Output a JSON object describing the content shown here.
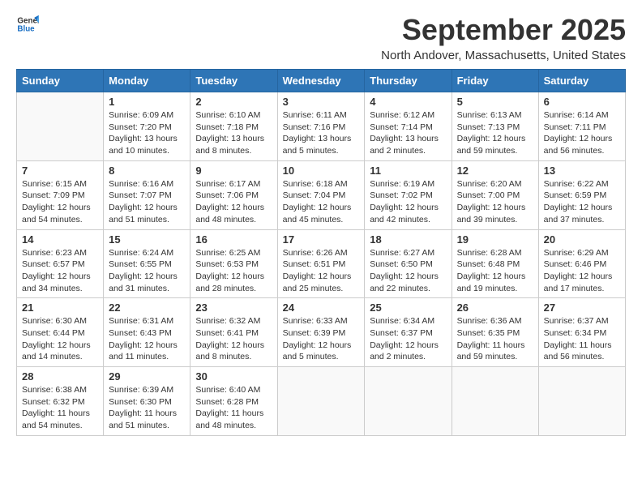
{
  "header": {
    "logo_general": "General",
    "logo_blue": "Blue",
    "month": "September 2025",
    "location": "North Andover, Massachusetts, United States"
  },
  "days_of_week": [
    "Sunday",
    "Monday",
    "Tuesday",
    "Wednesday",
    "Thursday",
    "Friday",
    "Saturday"
  ],
  "weeks": [
    [
      {
        "day": "",
        "content": ""
      },
      {
        "day": "1",
        "content": "Sunrise: 6:09 AM\nSunset: 7:20 PM\nDaylight: 13 hours\nand 10 minutes."
      },
      {
        "day": "2",
        "content": "Sunrise: 6:10 AM\nSunset: 7:18 PM\nDaylight: 13 hours\nand 8 minutes."
      },
      {
        "day": "3",
        "content": "Sunrise: 6:11 AM\nSunset: 7:16 PM\nDaylight: 13 hours\nand 5 minutes."
      },
      {
        "day": "4",
        "content": "Sunrise: 6:12 AM\nSunset: 7:14 PM\nDaylight: 13 hours\nand 2 minutes."
      },
      {
        "day": "5",
        "content": "Sunrise: 6:13 AM\nSunset: 7:13 PM\nDaylight: 12 hours\nand 59 minutes."
      },
      {
        "day": "6",
        "content": "Sunrise: 6:14 AM\nSunset: 7:11 PM\nDaylight: 12 hours\nand 56 minutes."
      }
    ],
    [
      {
        "day": "7",
        "content": "Sunrise: 6:15 AM\nSunset: 7:09 PM\nDaylight: 12 hours\nand 54 minutes."
      },
      {
        "day": "8",
        "content": "Sunrise: 6:16 AM\nSunset: 7:07 PM\nDaylight: 12 hours\nand 51 minutes."
      },
      {
        "day": "9",
        "content": "Sunrise: 6:17 AM\nSunset: 7:06 PM\nDaylight: 12 hours\nand 48 minutes."
      },
      {
        "day": "10",
        "content": "Sunrise: 6:18 AM\nSunset: 7:04 PM\nDaylight: 12 hours\nand 45 minutes."
      },
      {
        "day": "11",
        "content": "Sunrise: 6:19 AM\nSunset: 7:02 PM\nDaylight: 12 hours\nand 42 minutes."
      },
      {
        "day": "12",
        "content": "Sunrise: 6:20 AM\nSunset: 7:00 PM\nDaylight: 12 hours\nand 39 minutes."
      },
      {
        "day": "13",
        "content": "Sunrise: 6:22 AM\nSunset: 6:59 PM\nDaylight: 12 hours\nand 37 minutes."
      }
    ],
    [
      {
        "day": "14",
        "content": "Sunrise: 6:23 AM\nSunset: 6:57 PM\nDaylight: 12 hours\nand 34 minutes."
      },
      {
        "day": "15",
        "content": "Sunrise: 6:24 AM\nSunset: 6:55 PM\nDaylight: 12 hours\nand 31 minutes."
      },
      {
        "day": "16",
        "content": "Sunrise: 6:25 AM\nSunset: 6:53 PM\nDaylight: 12 hours\nand 28 minutes."
      },
      {
        "day": "17",
        "content": "Sunrise: 6:26 AM\nSunset: 6:51 PM\nDaylight: 12 hours\nand 25 minutes."
      },
      {
        "day": "18",
        "content": "Sunrise: 6:27 AM\nSunset: 6:50 PM\nDaylight: 12 hours\nand 22 minutes."
      },
      {
        "day": "19",
        "content": "Sunrise: 6:28 AM\nSunset: 6:48 PM\nDaylight: 12 hours\nand 19 minutes."
      },
      {
        "day": "20",
        "content": "Sunrise: 6:29 AM\nSunset: 6:46 PM\nDaylight: 12 hours\nand 17 minutes."
      }
    ],
    [
      {
        "day": "21",
        "content": "Sunrise: 6:30 AM\nSunset: 6:44 PM\nDaylight: 12 hours\nand 14 minutes."
      },
      {
        "day": "22",
        "content": "Sunrise: 6:31 AM\nSunset: 6:43 PM\nDaylight: 12 hours\nand 11 minutes."
      },
      {
        "day": "23",
        "content": "Sunrise: 6:32 AM\nSunset: 6:41 PM\nDaylight: 12 hours\nand 8 minutes."
      },
      {
        "day": "24",
        "content": "Sunrise: 6:33 AM\nSunset: 6:39 PM\nDaylight: 12 hours\nand 5 minutes."
      },
      {
        "day": "25",
        "content": "Sunrise: 6:34 AM\nSunset: 6:37 PM\nDaylight: 12 hours\nand 2 minutes."
      },
      {
        "day": "26",
        "content": "Sunrise: 6:36 AM\nSunset: 6:35 PM\nDaylight: 11 hours\nand 59 minutes."
      },
      {
        "day": "27",
        "content": "Sunrise: 6:37 AM\nSunset: 6:34 PM\nDaylight: 11 hours\nand 56 minutes."
      }
    ],
    [
      {
        "day": "28",
        "content": "Sunrise: 6:38 AM\nSunset: 6:32 PM\nDaylight: 11 hours\nand 54 minutes."
      },
      {
        "day": "29",
        "content": "Sunrise: 6:39 AM\nSunset: 6:30 PM\nDaylight: 11 hours\nand 51 minutes."
      },
      {
        "day": "30",
        "content": "Sunrise: 6:40 AM\nSunset: 6:28 PM\nDaylight: 11 hours\nand 48 minutes."
      },
      {
        "day": "",
        "content": ""
      },
      {
        "day": "",
        "content": ""
      },
      {
        "day": "",
        "content": ""
      },
      {
        "day": "",
        "content": ""
      }
    ]
  ]
}
